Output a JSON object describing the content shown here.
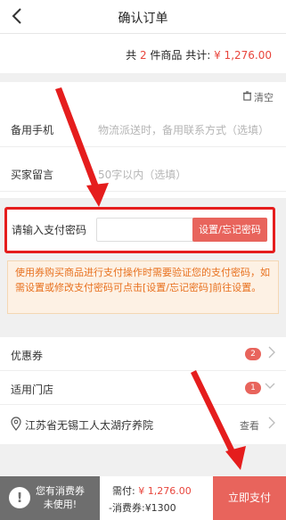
{
  "header": {
    "back_icon": "chevron-left-icon",
    "title": "确认订单"
  },
  "summary": {
    "prefix": "共",
    "count": "2",
    "mid": "件商品 共计:",
    "total": "¥ 1,276.00"
  },
  "form": {
    "clear_label": "清空",
    "clear_icon": "trash-icon",
    "phone_label": "备用手机",
    "phone_placeholder": "物流派送时，备用联系方式（选填）",
    "message_label": "买家留言",
    "message_placeholder": "50字以内（选填）"
  },
  "password": {
    "label": "请输入支付密码",
    "button": "设置/忘记密码"
  },
  "notice": {
    "text": "使用券购买商品进行支付操作时需要验证您的支付密码，如需设置或修改支付密码可点击[设置/忘记密码]前往设置。"
  },
  "coupon": {
    "label": "优惠券",
    "count": "2"
  },
  "store": {
    "label": "适用门店",
    "count": "1",
    "name": "江苏省无锡工人太湖疗养院",
    "view_label": "查看"
  },
  "footer": {
    "warn_line1": "您有消费券",
    "warn_line2": "未使用!",
    "pay_label": "需付:",
    "pay_amount": "¥ 1,276.00",
    "coupon_label": "-消费券:",
    "coupon_amount": "¥1300",
    "submit": "立即支付"
  },
  "colors": {
    "accent": "#e8645c",
    "highlight_border": "#e51d1d",
    "notice_text": "#e8711f"
  }
}
